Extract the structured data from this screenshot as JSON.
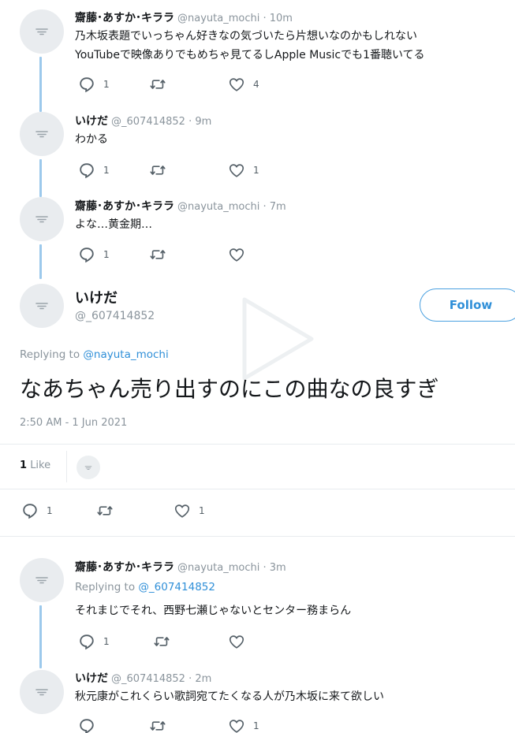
{
  "tweets": [
    {
      "name": "齋藤･あすか･キララ",
      "handle": "@nayuta_mochi",
      "time": "· 10m",
      "lines": [
        "乃木坂表題でいっちゃん好きなの気づいたら片想いなのかもしれない",
        "YouTubeで映像ありでもめちゃ見てるしApple Musicでも1番聴いてる"
      ],
      "replies": "1",
      "likes": "4"
    },
    {
      "name": "いけだ",
      "handle": "@_607414852",
      "time": "· 9m",
      "lines": [
        "わかる"
      ],
      "replies": "1",
      "likes": "1"
    },
    {
      "name": "齋藤･あすか･キララ",
      "handle": "@nayuta_mochi",
      "time": "· 7m",
      "lines": [
        "よな…黄金期…"
      ],
      "replies": "1",
      "likes": ""
    }
  ],
  "main": {
    "name": "いけだ",
    "handle": "@_607414852",
    "follow_label": "Follow",
    "replying_prefix": "Replying to ",
    "replying_handle": "@nayuta_mochi",
    "text": "なあちゃん売り出すのにこの曲なの良すぎ",
    "timestamp": "2:50 AM - 1 Jun 2021",
    "likes_count": "1",
    "likes_label": "Like",
    "replies": "1",
    "likes": "1"
  },
  "replies_below": [
    {
      "name": "齋藤･あすか･キララ",
      "handle": "@nayuta_mochi",
      "time": "· 3m",
      "replying_prefix": "Replying to ",
      "replying_handle": "@_607414852",
      "lines": [
        "それまじでそれ、西野七瀬じゃないとセンター務まらん"
      ],
      "replies": "1",
      "likes": ""
    },
    {
      "name": "いけだ",
      "handle": "@_607414852",
      "time": "· 2m",
      "lines": [
        "秋元康がこれくらい歌詞宛てたくなる人が乃木坂に来て欲しい"
      ],
      "replies": "",
      "likes": "1"
    }
  ],
  "colors": {
    "accent": "#2f8fd8",
    "thread_line": "#9cc9ec",
    "muted": "#8a949c"
  },
  "icons": [
    "avatar-placeholder-icon",
    "reply-icon",
    "retweet-icon",
    "like-icon",
    "play-icon"
  ]
}
